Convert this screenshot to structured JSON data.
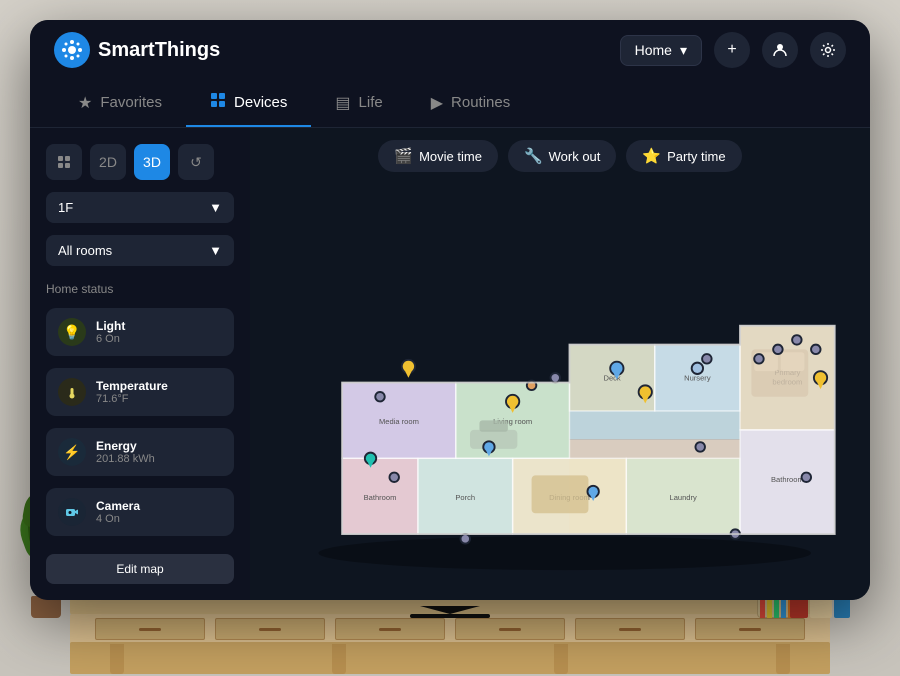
{
  "app": {
    "name": "SmartThings",
    "logo_icon": "✦"
  },
  "header": {
    "home_label": "Home",
    "add_label": "+",
    "profile_icon": "👤",
    "settings_icon": "⚙"
  },
  "nav": {
    "tabs": [
      {
        "id": "favorites",
        "label": "Favorites",
        "icon": "★",
        "active": false
      },
      {
        "id": "devices",
        "label": "Devices",
        "icon": "⊞",
        "active": true
      },
      {
        "id": "life",
        "label": "Life",
        "icon": "▤",
        "active": false
      },
      {
        "id": "routines",
        "label": "Routines",
        "icon": "▶",
        "active": false
      }
    ]
  },
  "sidebar": {
    "view_controls": [
      {
        "id": "grid",
        "label": "⊞",
        "active": false
      },
      {
        "id": "2d",
        "label": "2D",
        "active": false
      },
      {
        "id": "3d",
        "label": "3D",
        "active": true
      },
      {
        "id": "history",
        "label": "↺",
        "active": false
      }
    ],
    "floor": "1F",
    "floor_arrow": "▼",
    "room": "All rooms",
    "room_arrow": "▼",
    "home_status_label": "Home status",
    "status_items": [
      {
        "id": "light",
        "icon": "💡",
        "name": "Light",
        "value": "6 On",
        "type": "light"
      },
      {
        "id": "temperature",
        "icon": "🌡",
        "name": "Temperature",
        "value": "71.6°F",
        "type": "temp"
      },
      {
        "id": "energy",
        "icon": "⚡",
        "name": "Energy",
        "value": "201.88 kWh",
        "type": "energy"
      },
      {
        "id": "camera",
        "icon": "📷",
        "name": "Camera",
        "value": "4 On",
        "type": "camera"
      }
    ],
    "edit_map_label": "Edit map"
  },
  "quick_modes": [
    {
      "id": "movie",
      "icon": "🎬",
      "label": "Movie time"
    },
    {
      "id": "workout",
      "icon": "🔧",
      "label": "Work out"
    },
    {
      "id": "party",
      "icon": "⭐",
      "label": "Party time"
    }
  ],
  "colors": {
    "bg_dark": "#0e1220",
    "bg_card": "#1e2535",
    "accent_blue": "#1e88e5",
    "text_primary": "#ffffff",
    "text_secondary": "#888888"
  }
}
